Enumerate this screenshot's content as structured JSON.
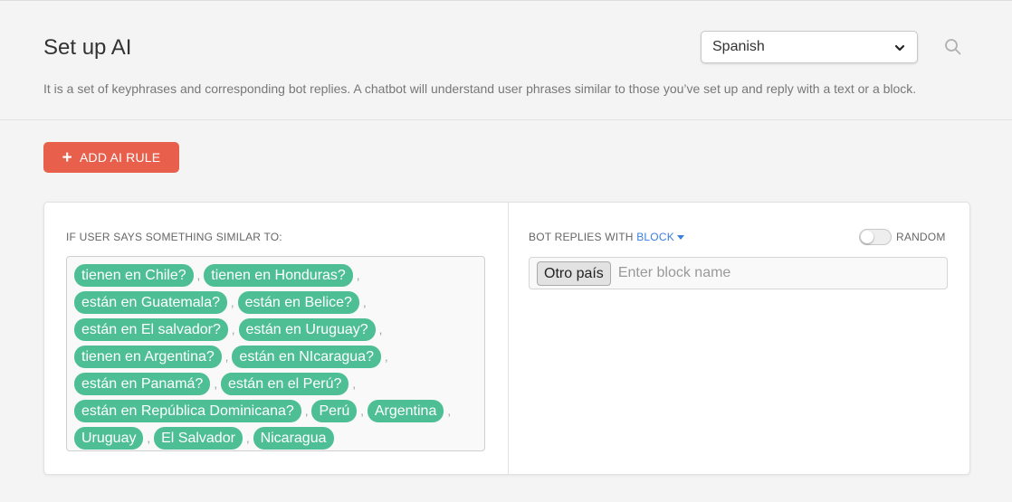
{
  "header": {
    "title": "Set up AI",
    "description": "It is a set of keyphrases and corresponding bot replies. A chatbot will understand user phrases similar to those you’ve set up and reply with a text or a block.",
    "language_select": {
      "selected": "Spanish",
      "icon": "chevron-down-icon"
    },
    "search_icon": "search-icon"
  },
  "toolbar": {
    "add_rule_label": "ADD AI RULE",
    "add_rule_icon": "+",
    "accent_color": "#e8604c"
  },
  "rule": {
    "user_says_label": "IF USER SAYS SOMETHING SIMILAR TO:",
    "phrases_rows": [
      [
        "tienen en Chile?",
        "tienen en Honduras?"
      ],
      [
        "están en Guatemala?",
        "están en Belice?"
      ],
      [
        "están en El salvador?",
        "están en Uruguay?"
      ],
      [
        "tienen en Argentina?",
        "están en NIcaragua?"
      ],
      [
        "están en Panamá?",
        "están en el Perú?"
      ],
      [
        "están en República Dominicana?",
        "Perú",
        "Argentina"
      ],
      [
        "Uruguay",
        "El Salvador",
        "Nicaragua"
      ]
    ],
    "phrase_tag_color": "#4ebf94",
    "bot_replies_label": "BOT REPLIES WITH",
    "reply_type": "BLOCK",
    "random_label": "RANDOM",
    "random_enabled": false,
    "selected_block": "Otro país",
    "block_placeholder": "Enter block name"
  }
}
